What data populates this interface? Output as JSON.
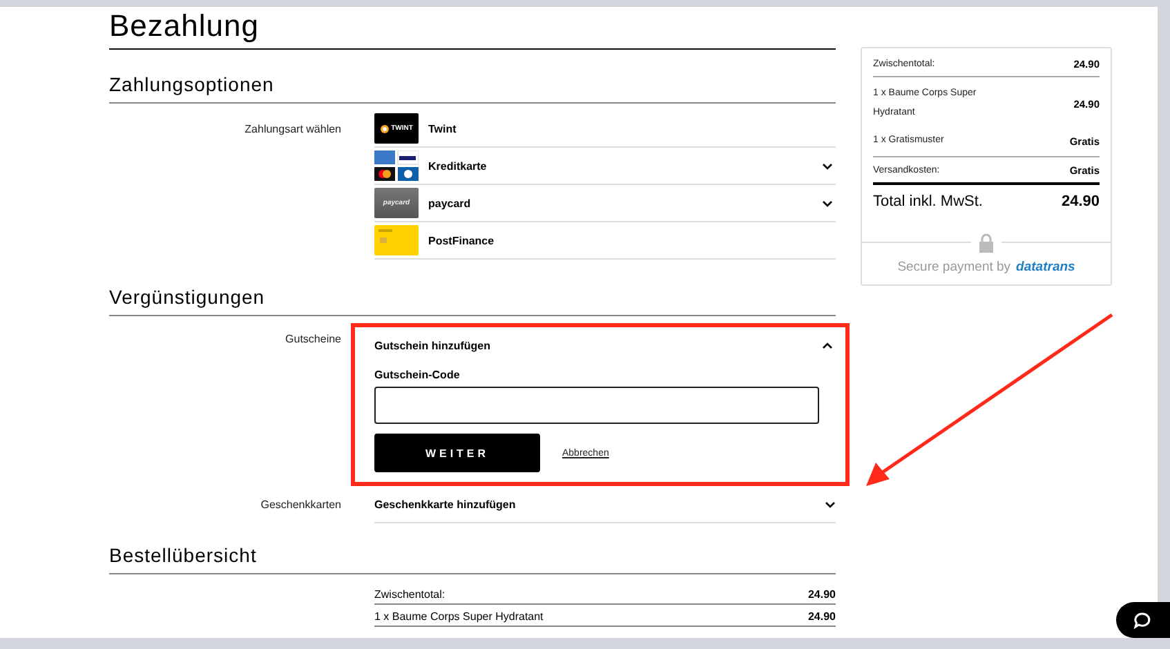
{
  "page": {
    "title": "Bezahlung"
  },
  "payment": {
    "heading": "Zahlungsoptionen",
    "label": "Zahlungsart wählen",
    "methods": [
      {
        "kind": "twint",
        "name": "Twint",
        "logo_text": "TWINT",
        "expandable": false
      },
      {
        "kind": "cards",
        "name": "Kreditkarte",
        "expandable": true
      },
      {
        "kind": "paycard",
        "name": "paycard",
        "logo_text": "paycard",
        "expandable": true
      },
      {
        "kind": "postfinance",
        "name": "PostFinance",
        "expandable": false
      }
    ]
  },
  "discounts": {
    "heading": "Vergünstigungen",
    "items": [
      {
        "label": "Gutscheine",
        "toggle": "Gutschein hinzufügen",
        "expanded": true,
        "highlighted": true,
        "field_label": "Gutschein-Code",
        "submit": "WEITER",
        "cancel": "Abbrechen"
      },
      {
        "label": "Geschenkkarten",
        "toggle": "Geschenkkarte hinzufügen",
        "expanded": false,
        "highlighted": false
      }
    ]
  },
  "summary": {
    "heading": "Bestellübersicht",
    "rows": [
      {
        "label": "Zwischentotal:",
        "value": "24.90"
      },
      {
        "label": "1 x Baume Corps Super Hydratant",
        "value": "24.90"
      }
    ]
  },
  "order_card": {
    "rows": [
      {
        "kind": "subtotal",
        "label": "Zwischentotal:",
        "value": "24.90"
      },
      {
        "kind": "item",
        "label": "1 x Baume Corps Super Hydratant",
        "value": "24.90"
      },
      {
        "kind": "item",
        "label": "1 x Gratismuster",
        "value": "Gratis"
      },
      {
        "kind": "shipping",
        "label": "Versandkosten:",
        "value": "Gratis"
      },
      {
        "kind": "total",
        "label": "Total inkl. MwSt.",
        "value": "24.90"
      }
    ],
    "secure_text": "Secure payment by",
    "provider": "datatrans"
  }
}
